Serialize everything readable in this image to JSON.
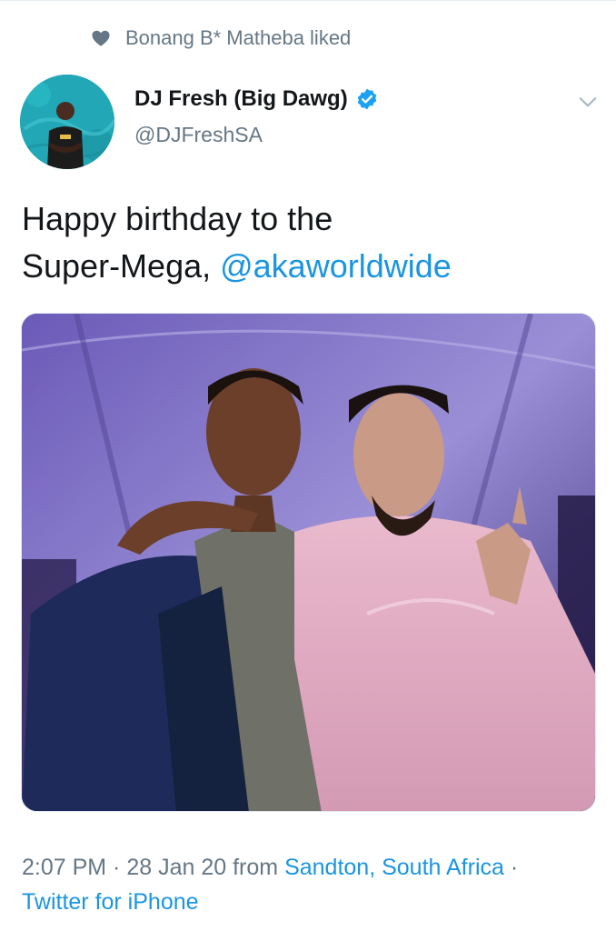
{
  "social_context": {
    "text": "Bonang B* Matheba liked",
    "icon": "heart-icon"
  },
  "author": {
    "display_name": "DJ Fresh (Big Dawg)",
    "handle": "@DJFreshSA",
    "verified": true
  },
  "tweet": {
    "text_line1": "Happy birthday to the",
    "text_line2_prefix": "Super-Mega, ",
    "mention": "@akaworldwide"
  },
  "meta": {
    "time": "2:07 PM",
    "separator": " · ",
    "date": "28 Jan 20",
    "from_text": " from ",
    "location": "Sandton, South Africa",
    "trailing_separator": " ·",
    "source": "Twitter for iPhone"
  },
  "colors": {
    "link": "#1b95e0",
    "muted": "#657786",
    "text": "#14171a"
  }
}
